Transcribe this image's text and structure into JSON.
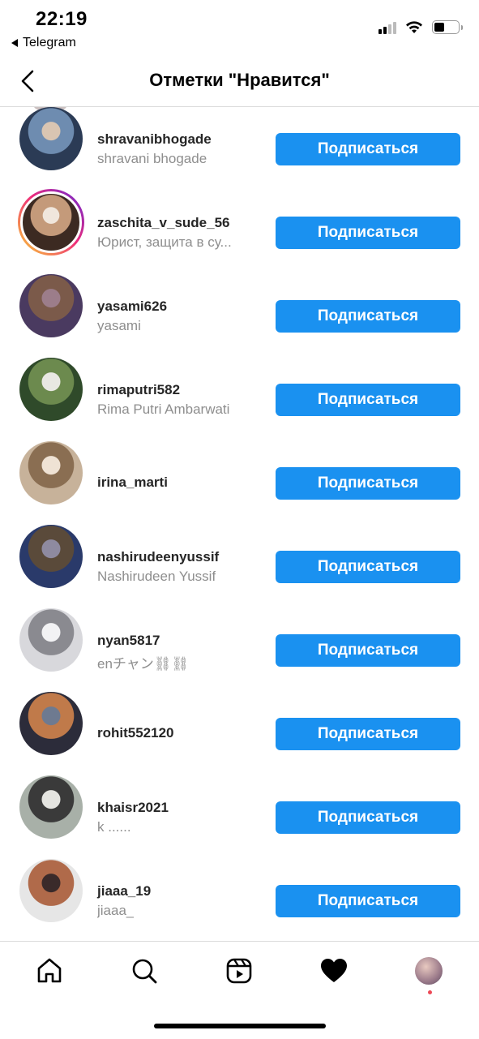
{
  "status_bar": {
    "time": "22:19",
    "back_app": "Telegram",
    "signal_bars": 2,
    "battery_level": 0.45
  },
  "header": {
    "title": "Отметки \"Нравится\"",
    "back_icon": "chevron-left-icon"
  },
  "follow_label": "Подписаться",
  "accent_color": "#1a91f0",
  "users": [
    {
      "username": "shravanibhogade",
      "full_name": "shravani bhogade",
      "avatar_colors": [
        "#2b3b55",
        "#6e8cb0",
        "#d9c5b2"
      ],
      "story": false
    },
    {
      "username": "zaschita_v_sude_56",
      "full_name": "Юрист, защита в су...",
      "avatar_colors": [
        "#3c2a22",
        "#c49a7a",
        "#f0e6dc"
      ],
      "story": true
    },
    {
      "username": "yasami626",
      "full_name": "yasami",
      "avatar_colors": [
        "#4a3a60",
        "#7b5a4a",
        "#9c7d8a"
      ],
      "story": false
    },
    {
      "username": "rimaputri582",
      "full_name": "Rima Putri Ambarwati",
      "avatar_colors": [
        "#2f4a2a",
        "#6c8a4e",
        "#e8e8e2"
      ],
      "story": false
    },
    {
      "username": "irina_marti",
      "full_name": "",
      "avatar_colors": [
        "#c7b29a",
        "#8a6e52",
        "#efe2d4"
      ],
      "story": false
    },
    {
      "username": "nashirudeenyussif",
      "full_name": "Nashirudeen Yussif",
      "avatar_colors": [
        "#2a3a6a",
        "#5a4a3a",
        "#8e8aa0"
      ],
      "story": false
    },
    {
      "username": "nyan5817",
      "full_name": "enチャン⛓⛓",
      "avatar_colors": [
        "#d8d8dc",
        "#8a8a90",
        "#f2f2f4"
      ],
      "story": false
    },
    {
      "username": "rohit552120",
      "full_name": "",
      "avatar_colors": [
        "#2c2c3a",
        "#c07a4a",
        "#6e7a90"
      ],
      "story": false
    },
    {
      "username": "khaisr2021",
      "full_name": "k ......",
      "avatar_colors": [
        "#a8b0a8",
        "#3a3a3a",
        "#e4e4e0"
      ],
      "story": false
    },
    {
      "username": "jiaaa_19",
      "full_name": "jiaaa_",
      "avatar_colors": [
        "#e6e6e6",
        "#b06a4a",
        "#3a2a2a"
      ],
      "story": false
    }
  ],
  "tabbar": {
    "items": [
      "home-icon",
      "search-icon",
      "reels-icon",
      "heart-icon",
      "profile-avatar"
    ],
    "profile_notification_color": "#ed4956"
  }
}
